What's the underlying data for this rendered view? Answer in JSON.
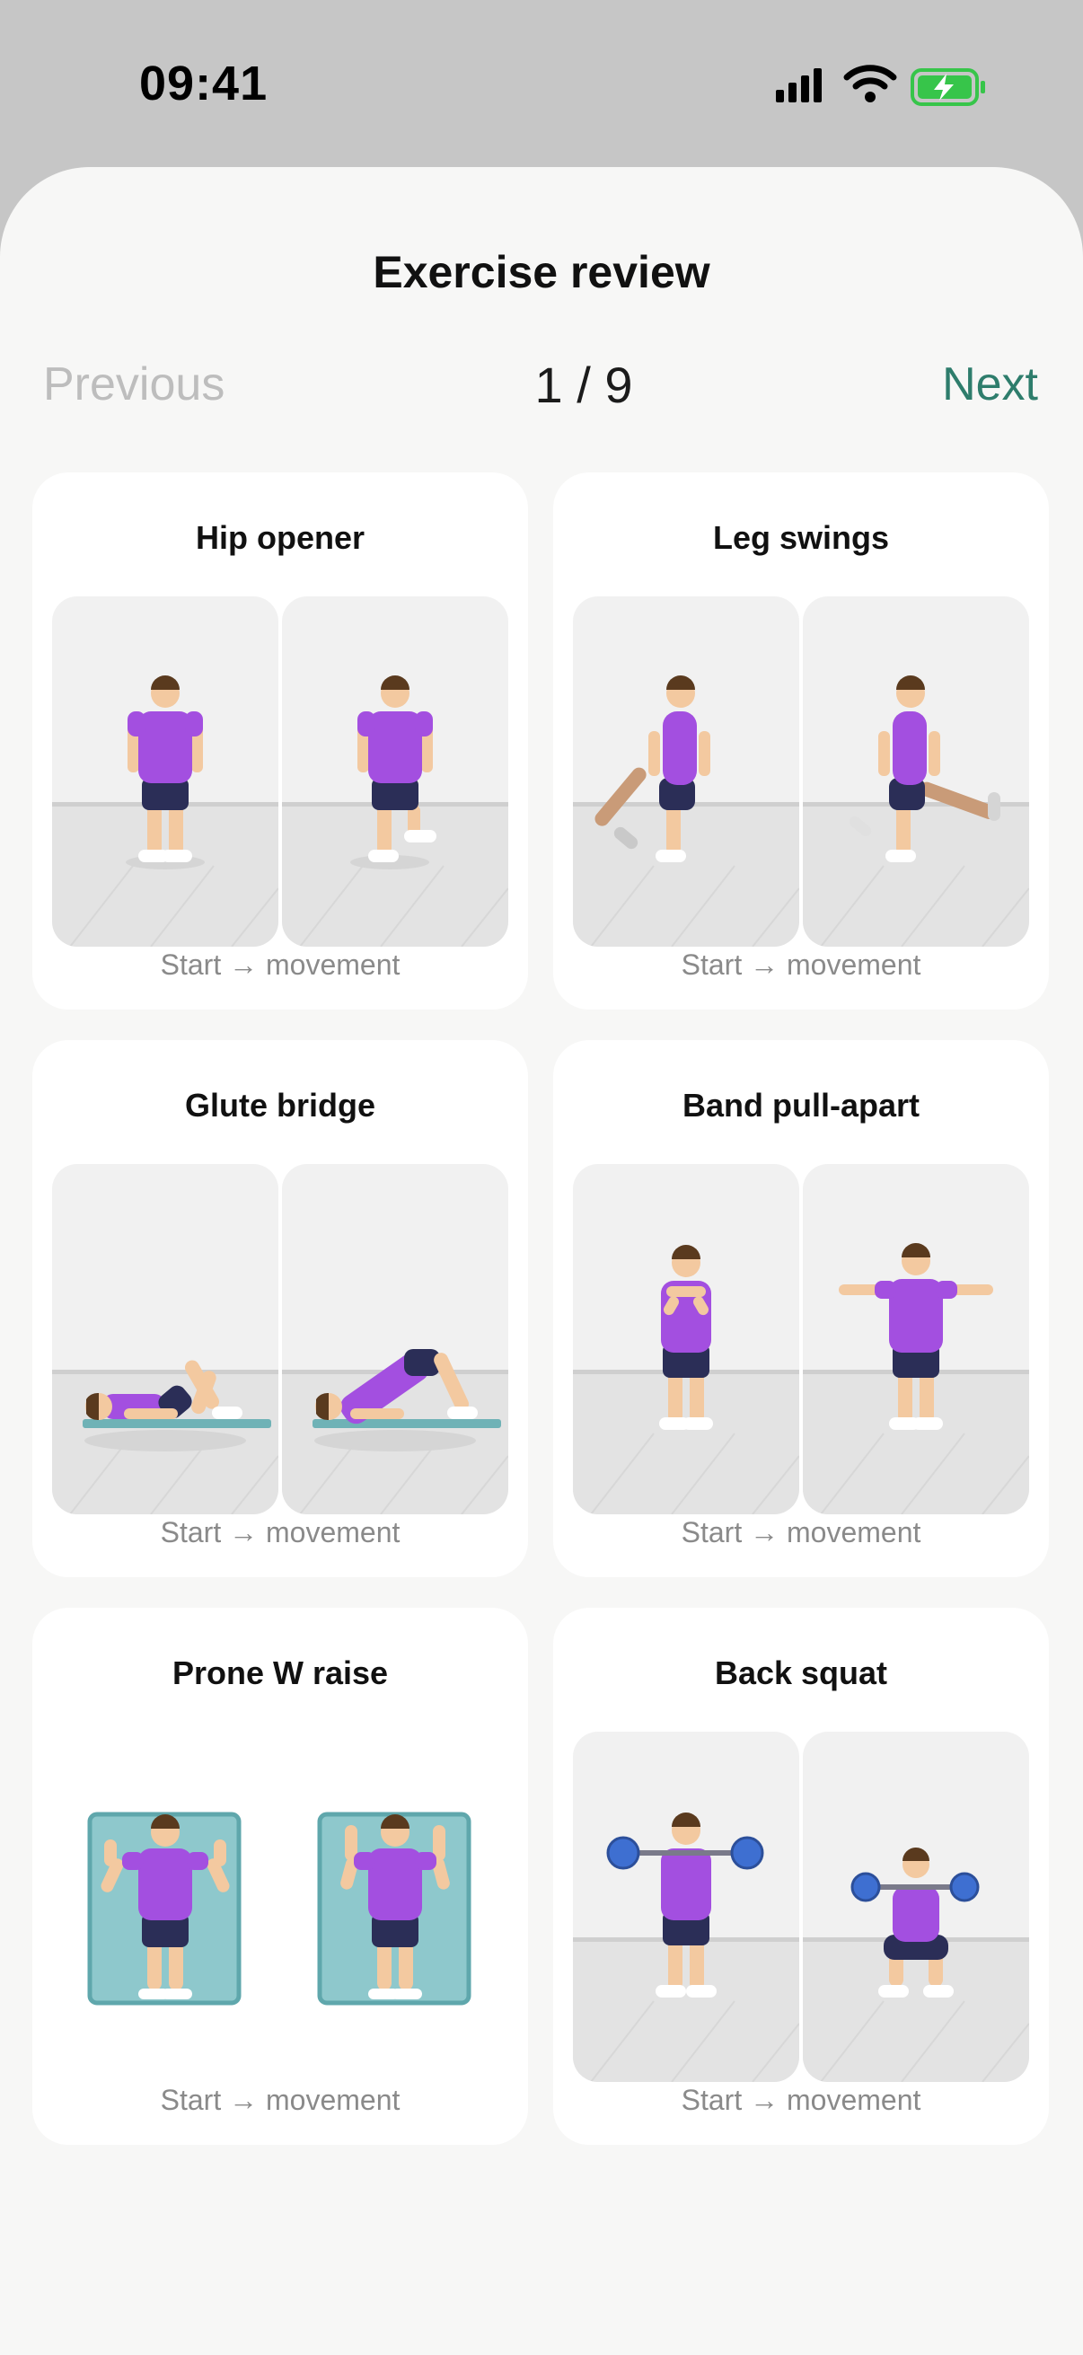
{
  "status": {
    "time": "09:41"
  },
  "header": {
    "title": "Exercise review"
  },
  "pager": {
    "previous": "Previous",
    "page": "1 / 9",
    "next": "Next"
  },
  "exercises": [
    {
      "title": "Hip opener",
      "caption": "Start → movement"
    },
    {
      "title": "Leg swings",
      "caption": "Start → movement"
    },
    {
      "title": "Glute bridge",
      "caption": "Start → movement"
    },
    {
      "title": "Band pull-apart",
      "caption": "Start → movement"
    },
    {
      "title": "Prone W raise",
      "caption": "Start → movement"
    },
    {
      "title": "Back squat",
      "caption": "Start → movement"
    }
  ],
  "colors": {
    "accent": "#2e7d6c",
    "shirt": "#a34fe0",
    "shorts": "#2b2e57",
    "skin": "#f3c9a0",
    "hair": "#5a3a1e",
    "mat": "#8ec8cc",
    "weight": "#3e6fd1"
  }
}
